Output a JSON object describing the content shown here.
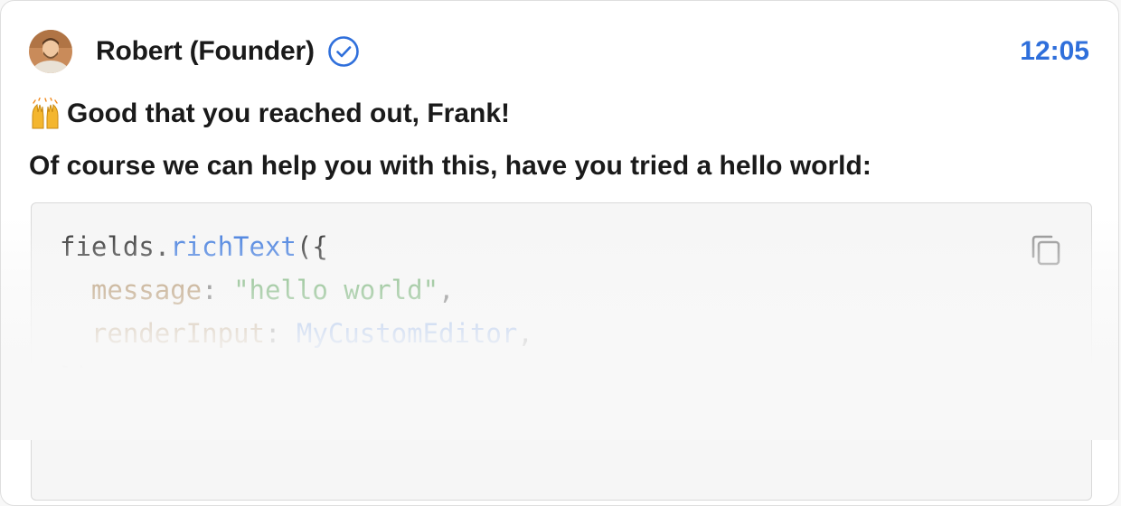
{
  "message": {
    "author": "Robert (Founder)",
    "time": "12:05",
    "greeting_emoji": "raising-hands-emoji",
    "greeting": "Good that you reached out, Frank!",
    "body": "Of course we can help you with this, have you tried a hello world:",
    "code_lines": [
      [
        {
          "text": "fields.",
          "kind": "plain"
        },
        {
          "text": "richText",
          "kind": "fn"
        },
        {
          "text": "({",
          "kind": "punct"
        }
      ],
      [
        {
          "text": "  ",
          "kind": "plain"
        },
        {
          "text": "message",
          "kind": "key"
        },
        {
          "text": ": ",
          "kind": "punct"
        },
        {
          "text": "\"hello world\"",
          "kind": "str"
        },
        {
          "text": ",",
          "kind": "punct"
        }
      ],
      [
        {
          "text": "  ",
          "kind": "plain"
        },
        {
          "text": "renderInput",
          "kind": "key"
        },
        {
          "text": ": ",
          "kind": "punct"
        },
        {
          "text": "MyCustomEditor",
          "kind": "ident"
        },
        {
          "text": ",",
          "kind": "punct"
        }
      ],
      [
        {
          "text": "});",
          "kind": "punct"
        }
      ]
    ],
    "icons": {
      "verified": "verified-check-icon",
      "copy": "copy-icon"
    }
  },
  "colors": {
    "accent": "#2f6fdb",
    "text": "#1a1a1a",
    "code_key": "#8c5a1c",
    "code_string": "#2e8b2e",
    "code_bg": "#f6f6f6"
  }
}
